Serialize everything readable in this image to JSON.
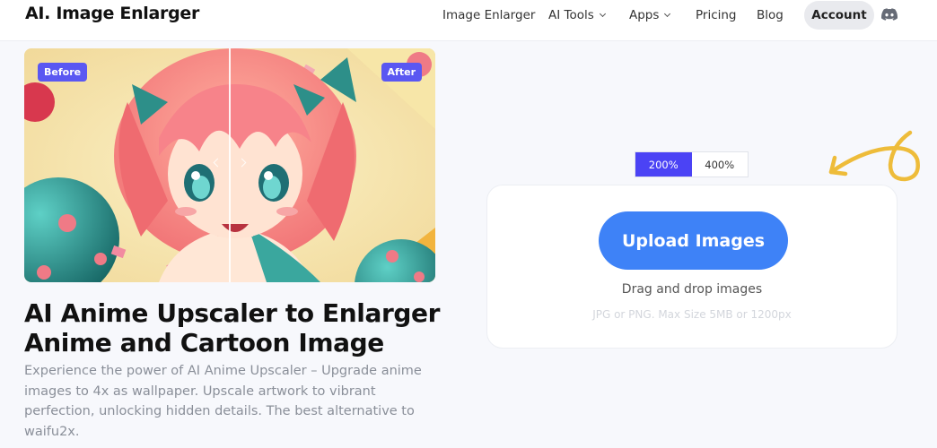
{
  "header": {
    "logo": "AI. Image Enlarger",
    "nav": [
      {
        "label": "Image Enlarger",
        "dropdown": false
      },
      {
        "label": "AI Tools",
        "dropdown": true
      },
      {
        "label": "Apps",
        "dropdown": true
      },
      {
        "label": "Pricing",
        "dropdown": false
      },
      {
        "label": "Blog",
        "dropdown": false
      }
    ],
    "account_label": "Account",
    "discord_icon": "discord-icon"
  },
  "compare": {
    "before_label": "Before",
    "after_label": "After"
  },
  "hero": {
    "title": "AI Anime Upscaler to Enlarger Anime and Cartoon Image",
    "description": "Experience the power of AI Anime Upscaler – Upgrade anime images to 4x as wallpaper. Upscale artwork to vibrant perfection, unlocking hidden details. The best alternative to waifu2x."
  },
  "scale": {
    "options": [
      "200%",
      "400%"
    ],
    "selected": "200%"
  },
  "upload": {
    "button_label": "Upload Images",
    "drag_text": "Drag and drop images",
    "hint_text": "JPG or PNG. Max Size 5MB or 1200px"
  },
  "colors": {
    "accent": "#4b43f5",
    "upload_button": "#3e82f7",
    "badge": "#5a57f2",
    "doodle": "#eebc3a"
  }
}
